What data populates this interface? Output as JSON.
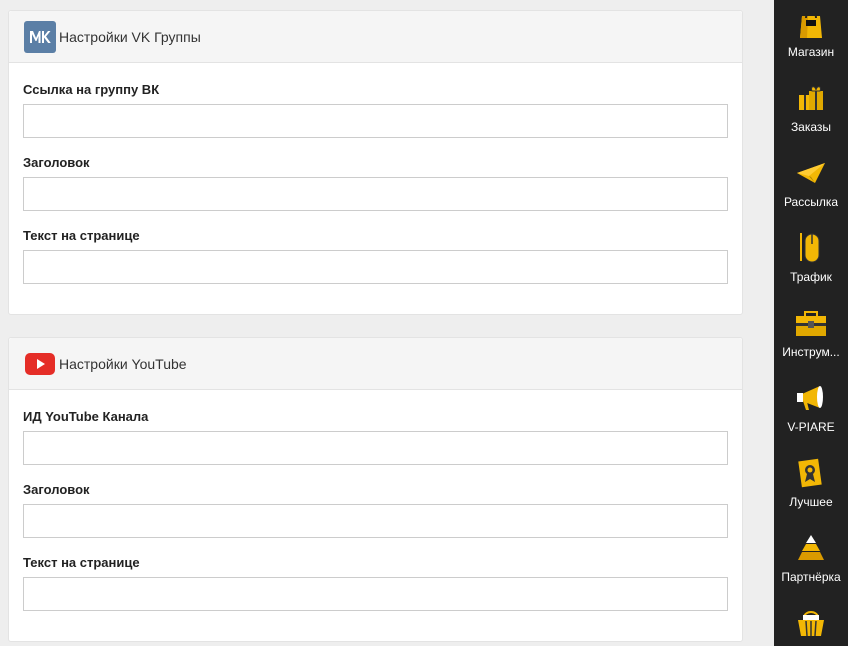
{
  "vk_section": {
    "title": "Настройки VK Группы",
    "fields": [
      {
        "label": "Ссылка на группу ВК",
        "value": "",
        "placeholder": ""
      },
      {
        "label": "Заголовок",
        "value": "",
        "placeholder": ""
      },
      {
        "label": "Текст на странице",
        "value": "",
        "placeholder": ""
      }
    ]
  },
  "youtube_section": {
    "title": "Настройки YouTube",
    "fields": [
      {
        "label": "ИД YouTube Канала",
        "value": "",
        "placeholder": ""
      },
      {
        "label": "Заголовок",
        "value": "",
        "placeholder": ""
      },
      {
        "label": "Текст на странице",
        "value": "",
        "placeholder": ""
      }
    ]
  },
  "sidebar": {
    "items": [
      {
        "label": "Магазин",
        "icon": "shopping-bag-icon"
      },
      {
        "label": "Заказы",
        "icon": "gift-boxes-icon"
      },
      {
        "label": "Рассылка",
        "icon": "paper-plane-icon"
      },
      {
        "label": "Трафик",
        "icon": "mouse-icon"
      },
      {
        "label": "Инструм...",
        "icon": "toolbox-icon"
      },
      {
        "label": "V-PIARE",
        "icon": "megaphone-icon"
      },
      {
        "label": "Лучшее",
        "icon": "certificate-icon"
      },
      {
        "label": "Партнёрка",
        "icon": "pyramid-icon"
      },
      {
        "label": "",
        "icon": "basket-icon"
      }
    ]
  },
  "colors": {
    "sidebar_bg": "#222222",
    "icon_accent": "#f2b705",
    "vk_brand": "#5b7fa6",
    "youtube_brand": "#e52d27"
  }
}
